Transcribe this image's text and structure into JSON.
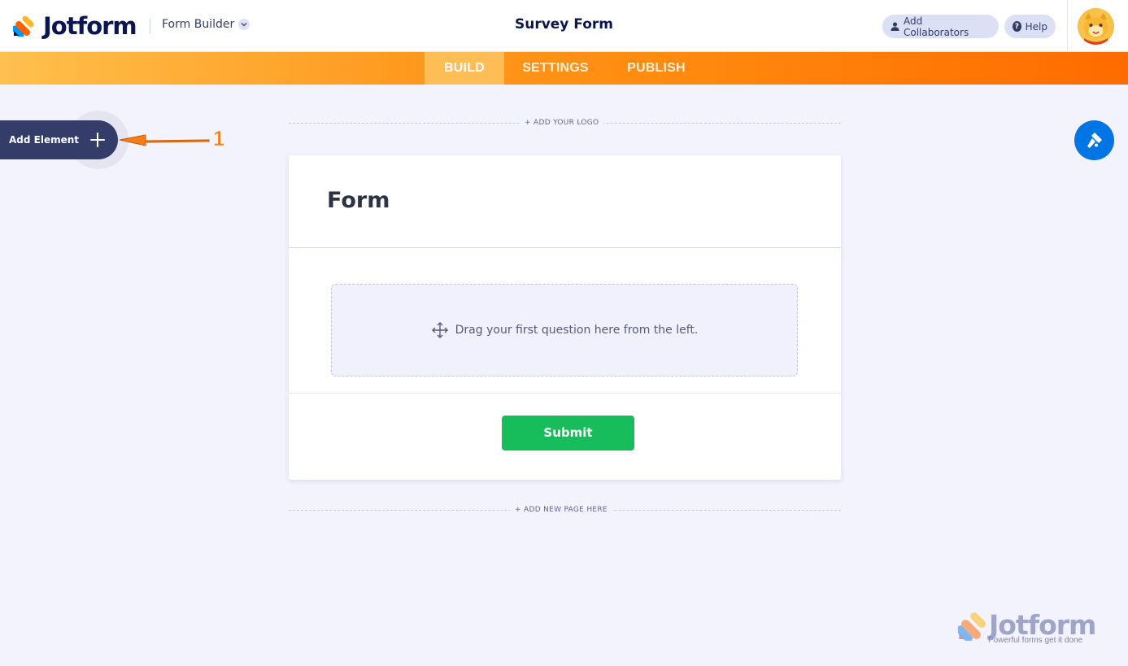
{
  "app": {
    "brand": "Jotform",
    "mode_label": "Form Builder",
    "form_title": "Survey Form"
  },
  "header": {
    "collaborators_label": "Add Collaborators",
    "help_label": "Help",
    "help_icon_glyph": "?"
  },
  "nav": {
    "tabs": [
      {
        "label": "BUILD",
        "active": true
      },
      {
        "label": "SETTINGS",
        "active": false
      },
      {
        "label": "PUBLISH",
        "active": false
      }
    ]
  },
  "sidebar": {
    "add_element_label": "Add Element"
  },
  "annotation": {
    "number": "1",
    "color": "#f57c16"
  },
  "canvas": {
    "add_logo_label": "+ ADD YOUR LOGO",
    "add_page_label": "+ ADD NEW PAGE HERE"
  },
  "form": {
    "heading": "Form",
    "dropzone_text": "Drag your first question here from the left.",
    "submit_label": "Submit"
  },
  "watermark": {
    "brand": "Jotform",
    "tagline": "Powerful forms get it done"
  },
  "colors": {
    "brand_navy": "#0a1551",
    "nav_orange_start": "#ffc04d",
    "nav_orange_end": "#ff6b00",
    "submit_green": "#18bd5b",
    "designer_blue": "#0075e3"
  },
  "icons": {
    "logo": "jotform-logo-icon",
    "builder_dropdown": "chevron-down-icon",
    "collaborators": "user-icon",
    "help": "help-icon",
    "add": "plus-icon",
    "move": "move-icon",
    "designer": "paint-roller-icon"
  }
}
